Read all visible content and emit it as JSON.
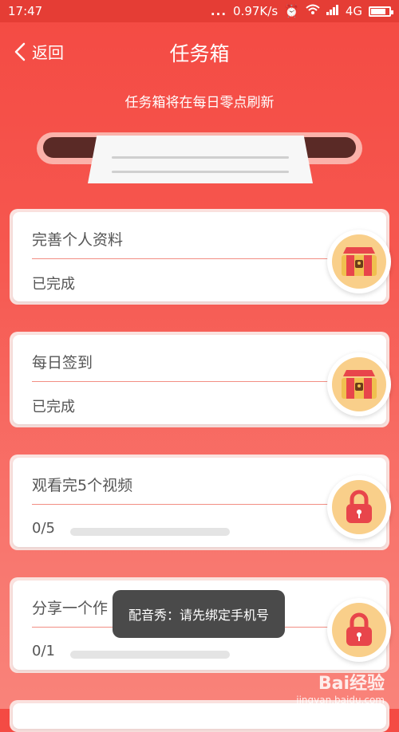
{
  "status_bar": {
    "time": "17:47",
    "dots": "...",
    "speed": "0.97K/s",
    "network": "4G"
  },
  "header": {
    "back_label": "返回",
    "title": "任务箱"
  },
  "subtitle": "任务箱将在每日零点刷新",
  "tasks": [
    {
      "title": "完善个人资料",
      "status": "已完成",
      "icon": "treasure-chest-open-icon"
    },
    {
      "title": "每日签到",
      "status": "已完成",
      "icon": "treasure-chest-open-icon"
    },
    {
      "title": "观看完5个视频",
      "progress_text": "0/5",
      "progress": 0.0,
      "icon": "locked-chest-icon"
    },
    {
      "title": "分享一个作",
      "progress_text": "0/1",
      "progress": 0.0,
      "icon": "locked-chest-icon"
    }
  ],
  "toast": "配音秀：请先绑定手机号",
  "watermark": {
    "brand": "Bai经验",
    "url": "jingyan.baidu.com"
  },
  "colors": {
    "accent": "#f44a43",
    "chest_bg": "#f9cf8a",
    "toast_bg": "#4a4a4a"
  }
}
